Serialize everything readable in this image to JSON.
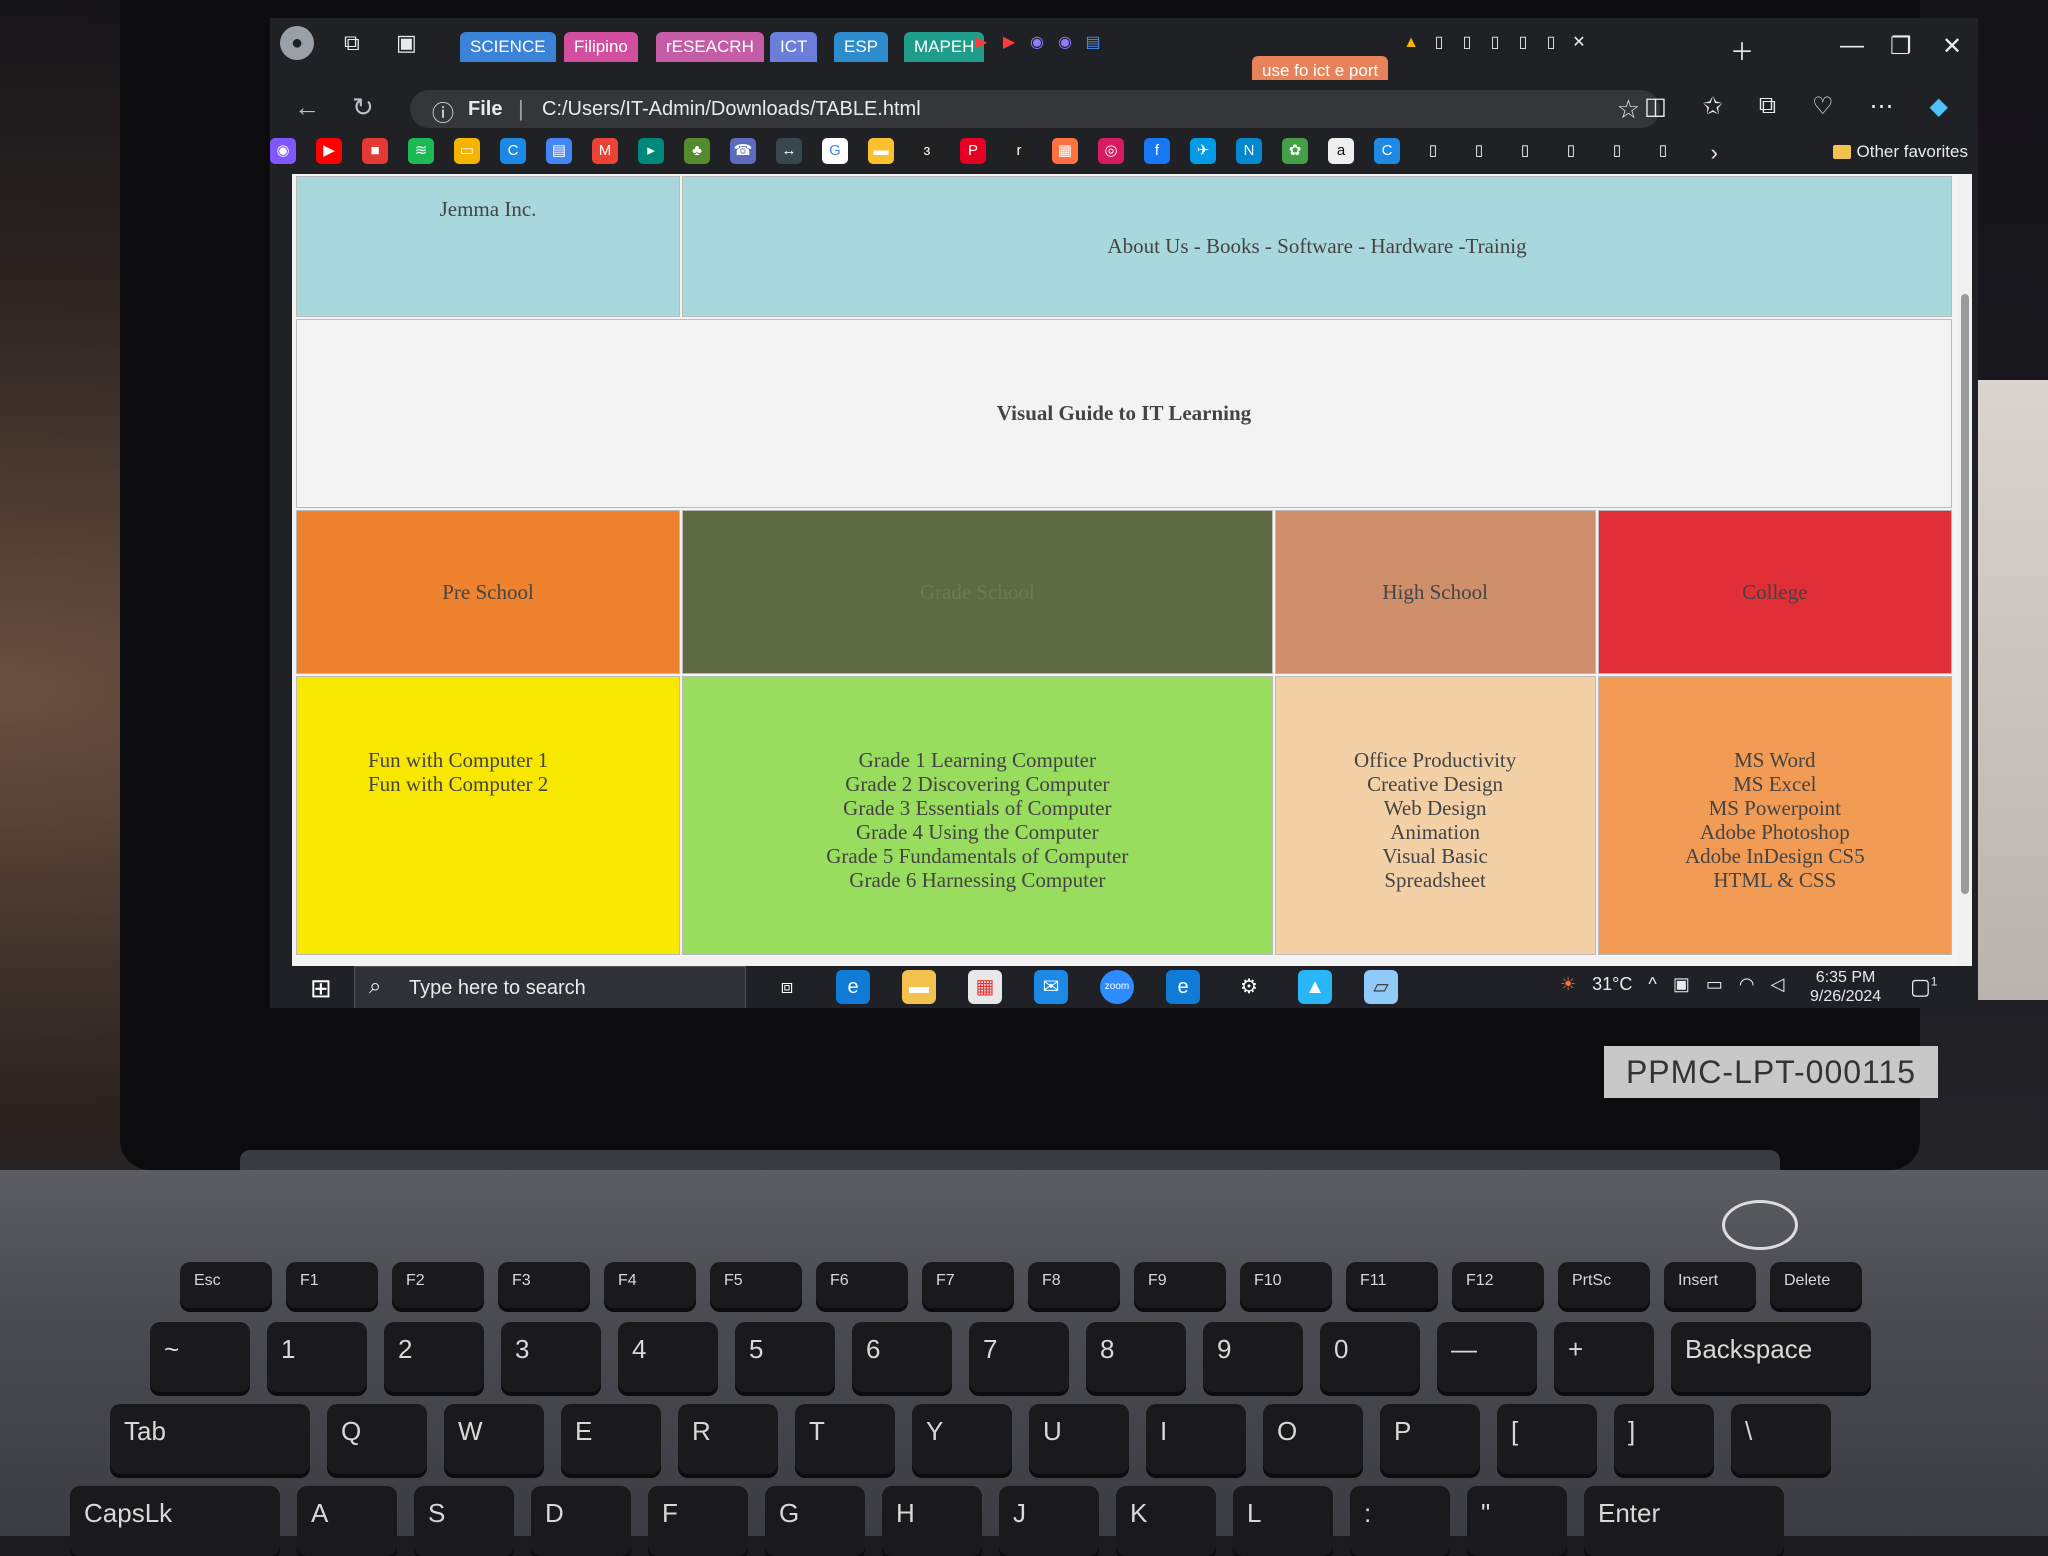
{
  "browser": {
    "tab_groups": [
      {
        "label": "SCIENCE",
        "color": "#3b83d9"
      },
      {
        "label": "Filipino",
        "color": "#d14f9e"
      },
      {
        "label": "rESEACRH",
        "color": "#c45ca6"
      },
      {
        "label": "ICT",
        "color": "#6b7ed9"
      },
      {
        "label": "ESP",
        "color": "#2d8ccb"
      },
      {
        "label": "MAPEH",
        "color": "#1e9e8a"
      }
    ],
    "orange_tab": "use fo ict e  port",
    "address": {
      "scheme_label": "File",
      "url": "C:/Users/IT-Admin/Downloads/TABLE.html"
    },
    "favorites_label": "Other favorites"
  },
  "page": {
    "company": "Jemma Inc.",
    "nav": "About Us - Books - Software - Hardware -Trainig",
    "banner": "Visual Guide to IT Learning",
    "levels": [
      {
        "label": "Pre School"
      },
      {
        "label": "Grade School"
      },
      {
        "label": "High School"
      },
      {
        "label": "College"
      }
    ],
    "courses": [
      [
        "Fun with Computer 1",
        "Fun with Computer 2"
      ],
      [
        "Grade 1 Learning Computer",
        "Grade 2 Discovering Computer",
        "Grade 3 Essentials of Computer",
        "Grade 4 Using the Computer",
        "Grade 5 Fundamentals of Computer",
        "Grade 6 Harnessing Computer"
      ],
      [
        "Office Productivity",
        "Creative Design",
        "Web Design",
        "Animation",
        "Visual Basic",
        "Spreadsheet"
      ],
      [
        "MS Word",
        "MS Excel",
        "MS Powerpoint",
        "Adobe Photoshop",
        "Adobe InDesign CS5",
        "HTML & CSS"
      ]
    ]
  },
  "taskbar": {
    "search_placeholder": "Type here to search",
    "temperature": "31°C",
    "time": "6:35 PM",
    "date": "9/26/2024",
    "notification_count": "1"
  },
  "asset_tag": "PPMC-LPT-000115",
  "keyboard": {
    "fn_row": [
      "Esc",
      "F1",
      "F2",
      "F3",
      "F4",
      "F5",
      "F6",
      "F7",
      "F8",
      "F9",
      "F10",
      "F11",
      "F12",
      "PrtSc",
      "Insert",
      "Delete"
    ],
    "num_row": [
      "~",
      "1",
      "2",
      "3",
      "4",
      "5",
      "6",
      "7",
      "8",
      "9",
      "0",
      "—",
      "+",
      "Backspace"
    ],
    "qwerty_row": [
      "Tab",
      "Q",
      "W",
      "E",
      "R",
      "T",
      "Y",
      "U",
      "I",
      "O",
      "P",
      "[",
      "]",
      "\\"
    ],
    "home_row": [
      "CapsLk",
      "A",
      "S",
      "D",
      "F",
      "G",
      "H",
      "J",
      "K",
      "L",
      ":",
      "\"",
      "Enter"
    ]
  }
}
